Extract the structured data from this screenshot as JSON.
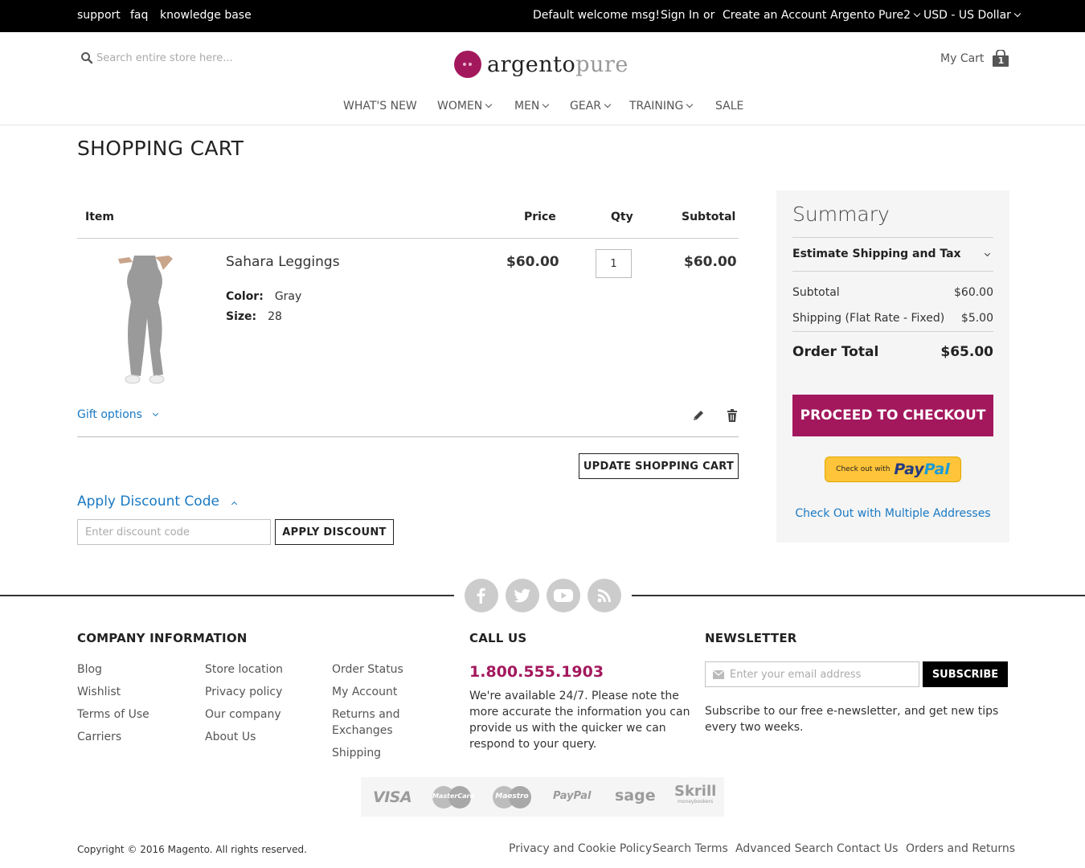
{
  "topbar": {
    "links_left": [
      "support",
      "faq",
      "knowledge base"
    ],
    "welcome": "Default welcome msg!",
    "sign_in": "Sign In",
    "or": "or",
    "create_account": "Create an Account",
    "store": "Argento Pure2",
    "currency": "USD - US Dollar"
  },
  "header": {
    "search_placeholder": "Search entire store here...",
    "logo_part1": "argento",
    "logo_part2": "pure",
    "my_cart": "My Cart",
    "cart_count": "1"
  },
  "nav": [
    "WHAT'S NEW",
    "WOMEN",
    "MEN",
    "GEAR",
    "TRAINING",
    "SALE"
  ],
  "page_title": "SHOPPING CART",
  "cart": {
    "headers": {
      "item": "Item",
      "price": "Price",
      "qty": "Qty",
      "subtotal": "Subtotal"
    },
    "item": {
      "name": "Sahara Leggings",
      "color_label": "Color:",
      "color": "Gray",
      "size_label": "Size:",
      "size": "28",
      "price": "$60.00",
      "qty": "1",
      "subtotal": "$60.00"
    },
    "gift_options": "Gift options",
    "update_button": "UPDATE SHOPPING CART",
    "discount_title": "Apply Discount Code",
    "discount_placeholder": "Enter discount code",
    "apply_button": "APPLY DISCOUNT"
  },
  "summary": {
    "title": "Summary",
    "estimate": "Estimate Shipping and Tax",
    "subtotal_label": "Subtotal",
    "subtotal": "$60.00",
    "shipping_label": "Shipping (Flat Rate - Fixed)",
    "shipping": "$5.00",
    "total_label": "Order Total",
    "total": "$65.00",
    "checkout_button": "PROCEED TO CHECKOUT",
    "paypal_prefix": "Check out with",
    "paypal_brand_1": "Pay",
    "paypal_brand_2": "Pal",
    "multi_address": "Check Out with Multiple Addresses"
  },
  "footer": {
    "social_icons": [
      "facebook-icon",
      "twitter-icon",
      "youtube-icon",
      "rss-icon"
    ],
    "company_title": "COMPANY INFORMATION",
    "col1": [
      "Blog",
      "Wishlist",
      "Terms of Use",
      "Carriers"
    ],
    "col2": [
      "Store location",
      "Privacy policy",
      "Our company",
      "About Us"
    ],
    "col3": [
      "Order Status",
      "My Account",
      "Returns and Exchanges",
      "Shipping"
    ],
    "call_title": "CALL US",
    "phone": "1.800.555.1903",
    "call_text": "We're available 24/7. Please note the more accurate the information you can provide us with the quicker we can respond to your query.",
    "newsletter_title": "NEWSLETTER",
    "newsletter_placeholder": "Enter your email address",
    "subscribe": "SUBSCRIBE",
    "newsletter_text": "Subscribe to our free e-newsletter, and get new tips every two weeks.",
    "payments": [
      "VISA",
      "MasterCard",
      "Maestro",
      "PayPal",
      "sage",
      "Skrill",
      "moneybookers"
    ],
    "copyright": "Copyright © 2016 Magento. All rights reserved.",
    "bottom_links": [
      "Privacy and Cookie Policy",
      "Search Terms",
      "Advanced Search",
      "Contact Us",
      "Orders and Returns"
    ]
  },
  "colors": {
    "brand": "#a3185d",
    "link": "#1979c3",
    "topbar": "#000000"
  }
}
